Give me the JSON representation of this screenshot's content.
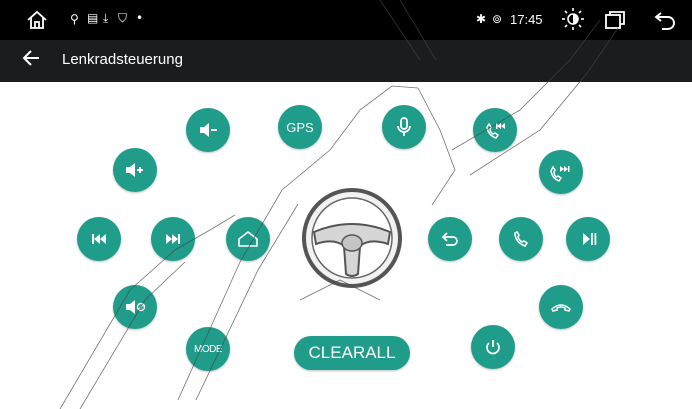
{
  "status_bar": {
    "time": "17:45",
    "icons": [
      "home-icon",
      "usb-icon",
      "sd-card-icon",
      "download-icon",
      "shield-icon",
      "dot-icon",
      "bluetooth-icon",
      "location-icon",
      "brightness-icon",
      "recent-apps-icon",
      "back-arrow-icon"
    ]
  },
  "app_bar": {
    "title": "Lenkradsteuerung",
    "back_icon": "arrow-left-icon"
  },
  "buttons": {
    "gps": "GPS",
    "mode": "MODE",
    "clear_all": "CLEARALL"
  },
  "colors": {
    "accent": "#1f9c8a",
    "status_bar": "#000000",
    "app_bar": "#1a1c20",
    "background": "#ffffff"
  }
}
